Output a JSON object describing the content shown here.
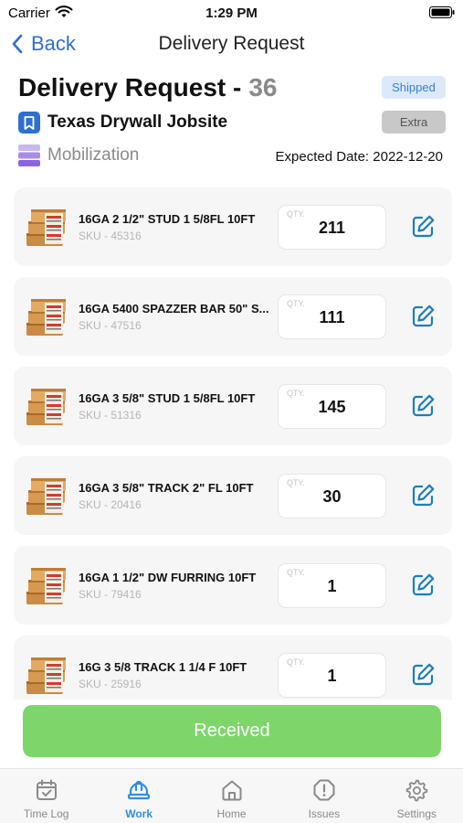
{
  "status_bar": {
    "carrier": "Carrier",
    "time": "1:29 PM"
  },
  "nav": {
    "back_label": "Back",
    "title": "Delivery Request"
  },
  "header": {
    "title": "Delivery Request -",
    "number": "36",
    "status": "Shipped",
    "jobsite": "Texas Drywall Jobsite",
    "type_badge": "Extra",
    "phase": "Mobilization",
    "expected_date": "Expected Date: 2022-12-20"
  },
  "qty_label": "QTY.",
  "items": [
    {
      "name": "16GA 2 1/2\" STUD 1 5/8FL 10FT",
      "sku": "SKU - 45316",
      "qty": "211"
    },
    {
      "name": "16GA 5400 SPAZZER BAR 50\" S...",
      "sku": "SKU - 47516",
      "qty": "111"
    },
    {
      "name": "16GA 3 5/8\" STUD 1 5/8FL 10FT",
      "sku": "SKU - 51316",
      "qty": "145"
    },
    {
      "name": "16GA 3 5/8\" TRACK 2\" FL 10FT",
      "sku": "SKU - 20416",
      "qty": "30"
    },
    {
      "name": "16GA 1 1/2\" DW FURRING 10FT",
      "sku": "SKU - 79416",
      "qty": "1"
    },
    {
      "name": "16G 3 5/8 TRACK 1 1/4 F 10FT",
      "sku": "SKU - 25916",
      "qty": "1"
    }
  ],
  "received_button": "Received",
  "tabs": [
    {
      "label": "Time Log",
      "icon": "calendar-check-icon",
      "active": false
    },
    {
      "label": "Work",
      "icon": "hard-hat-icon",
      "active": true
    },
    {
      "label": "Home",
      "icon": "home-icon",
      "active": false
    },
    {
      "label": "Issues",
      "icon": "alert-icon",
      "active": false
    },
    {
      "label": "Settings",
      "icon": "gear-icon",
      "active": false
    }
  ],
  "colors": {
    "accent": "#2f6fce",
    "tab_active": "#2f8fe0",
    "received": "#7ed66a",
    "shipped_bg": "#dbe9fb",
    "shipped_text": "#3b7fd6"
  }
}
